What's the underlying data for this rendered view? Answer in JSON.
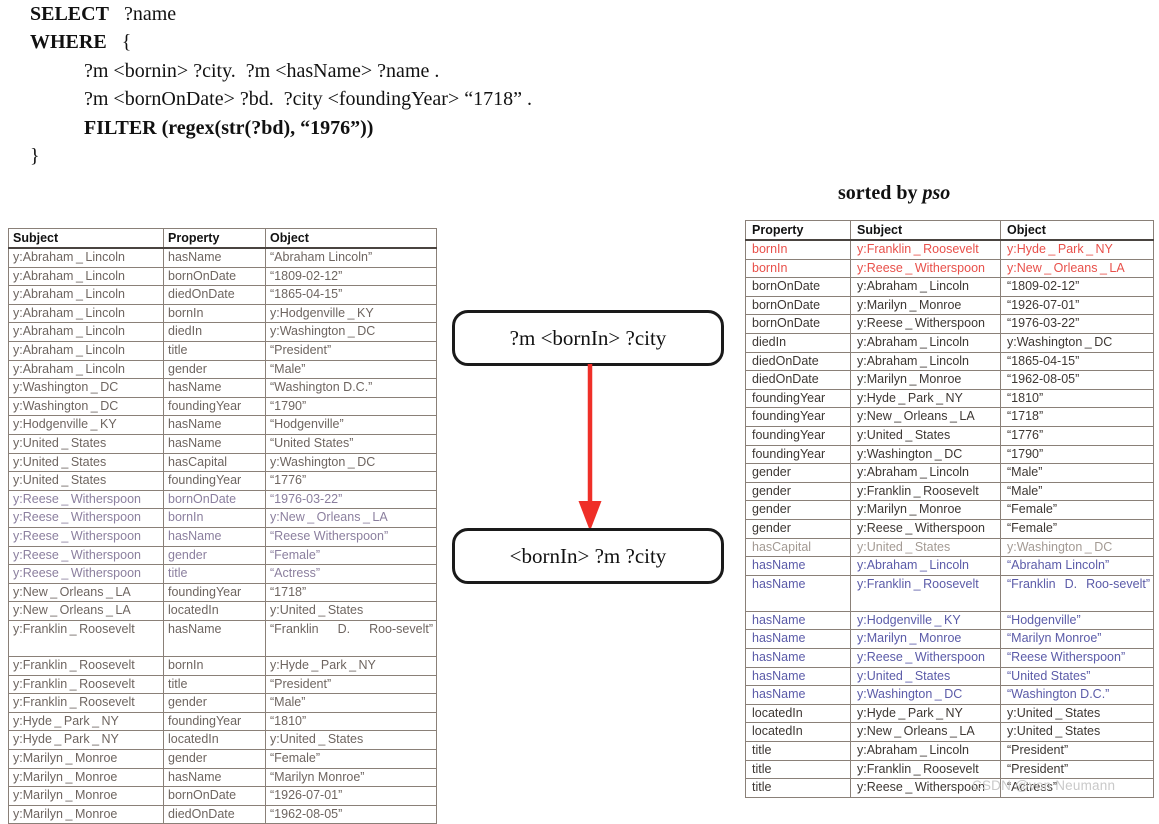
{
  "query": {
    "lines": [
      {
        "kw": "SELECT",
        "rest": "   ?name",
        "indent": 0
      },
      {
        "kw": "WHERE",
        "rest": "   {",
        "indent": 0
      },
      {
        "kw": "",
        "rest": "?m <bornin> ?city.  ?m <hasName> ?name .",
        "indent": 1
      },
      {
        "kw": "",
        "rest": "?m <bornOnDate> ?bd.  ?city <foundingYear> “1718” .",
        "indent": 1
      },
      {
        "kw": "FILTER (regex(str(?bd), “1976”))",
        "rest": "",
        "indent": 2
      },
      {
        "kw": "",
        "rest": "}",
        "indent": 0
      }
    ]
  },
  "caption": {
    "prefix": "sorted by ",
    "emphasis": "pso"
  },
  "left_table": {
    "headers": [
      "Subject",
      "Property",
      "Object"
    ],
    "rows": [
      {
        "color": "c-default",
        "cells": [
          "y:Abraham␣Lincoln",
          "hasName",
          "“Abraham Lincoln”"
        ]
      },
      {
        "color": "c-default",
        "cells": [
          "y:Abraham␣Lincoln",
          "bornOnDate",
          "“1809-02-12”"
        ]
      },
      {
        "color": "c-default",
        "cells": [
          "y:Abraham␣Lincoln",
          "diedOnDate",
          "“1865-04-15”"
        ]
      },
      {
        "color": "c-default",
        "cells": [
          "y:Abraham␣Lincoln",
          "bornIn",
          "y:Hodgenville␣KY"
        ]
      },
      {
        "color": "c-default",
        "cells": [
          "y:Abraham␣Lincoln",
          "diedIn",
          "y:Washington␣DC"
        ]
      },
      {
        "color": "c-default",
        "cells": [
          "y:Abraham␣Lincoln",
          "title",
          "“President”"
        ]
      },
      {
        "color": "c-default",
        "cells": [
          "y:Abraham␣Lincoln",
          "gender",
          "“Male”"
        ]
      },
      {
        "color": "c-default",
        "cells": [
          "y:Washington␣DC",
          "hasName",
          "“Washington D.C.”"
        ]
      },
      {
        "color": "c-default",
        "cells": [
          "y:Washington␣DC",
          "foundingYear",
          "“1790”"
        ]
      },
      {
        "color": "c-default",
        "cells": [
          "y:Hodgenville␣KY",
          "hasName",
          "“Hodgenville”"
        ]
      },
      {
        "color": "c-default",
        "cells": [
          "y:United␣States",
          "hasName",
          "“United States”"
        ]
      },
      {
        "color": "c-default",
        "cells": [
          "y:United␣States",
          "hasCapital",
          "y:Washington␣DC"
        ]
      },
      {
        "color": "c-default",
        "cells": [
          "y:United␣States",
          "foundingYear",
          "“1776”"
        ]
      },
      {
        "color": "c-violet",
        "cells": [
          "y:Reese␣Witherspoon",
          "bornOnDate",
          "“1976-03-22”"
        ]
      },
      {
        "color": "c-violet",
        "cells": [
          "y:Reese␣Witherspoon",
          "bornIn",
          "y:New␣Orleans␣LA"
        ]
      },
      {
        "color": "c-violet",
        "cells": [
          "y:Reese␣Witherspoon",
          "hasName",
          "“Reese Witherspoon”"
        ]
      },
      {
        "color": "c-violet",
        "cells": [
          "y:Reese␣Witherspoon",
          "gender",
          "“Female”"
        ]
      },
      {
        "color": "c-violet",
        "cells": [
          "y:Reese␣Witherspoon",
          "title",
          "“Actress”"
        ]
      },
      {
        "color": "c-default",
        "cells": [
          "y:New␣Orleans␣LA",
          "foundingYear",
          "“1718”"
        ]
      },
      {
        "color": "c-default",
        "cells": [
          "y:New␣Orleans␣LA",
          "locatedIn",
          "y:United␣States"
        ]
      },
      {
        "color": "c-default",
        "tall": true,
        "cells": [
          "y:Franklin␣Roosevelt",
          "hasName",
          "“Franklin D. Roo-sevelt”"
        ]
      },
      {
        "color": "c-default",
        "cells": [
          "y:Franklin␣Roosevelt",
          "bornIn",
          "y:Hyde␣Park␣NY"
        ]
      },
      {
        "color": "c-default",
        "cells": [
          "y:Franklin␣Roosevelt",
          "title",
          "“President”"
        ]
      },
      {
        "color": "c-default",
        "cells": [
          "y:Franklin␣Roosevelt",
          "gender",
          "“Male”"
        ]
      },
      {
        "color": "c-default",
        "cells": [
          "y:Hyde␣Park␣NY",
          "foundingYear",
          "“1810”"
        ]
      },
      {
        "color": "c-default",
        "cells": [
          "y:Hyde␣Park␣NY",
          "locatedIn",
          "y:United␣States"
        ]
      },
      {
        "color": "c-default",
        "cells": [
          "y:Marilyn␣Monroe",
          "gender",
          "“Female”"
        ]
      },
      {
        "color": "c-default",
        "cells": [
          "y:Marilyn␣Monroe",
          "hasName",
          "“Marilyn Monroe”"
        ]
      },
      {
        "color": "c-default",
        "cells": [
          "y:Marilyn␣Monroe",
          "bornOnDate",
          "“1926-07-01”"
        ]
      },
      {
        "color": "c-default",
        "cells": [
          "y:Marilyn␣Monroe",
          "diedOnDate",
          "“1962-08-05”"
        ]
      }
    ]
  },
  "right_table": {
    "headers": [
      "Property",
      "Subject",
      "Object"
    ],
    "rows": [
      {
        "color": "c-red",
        "cells": [
          "bornIn",
          "y:Franklin␣Roosevelt",
          "y:Hyde␣Park␣NY"
        ]
      },
      {
        "color": "c-red",
        "cells": [
          "bornIn",
          "y:Reese␣Witherspoon",
          "y:New␣Orleans␣LA"
        ]
      },
      {
        "color": "c-dark",
        "cells": [
          "bornOnDate",
          "y:Abraham␣Lincoln",
          "“1809-02-12”"
        ]
      },
      {
        "color": "c-dark",
        "cells": [
          "bornOnDate",
          "y:Marilyn␣Monroe",
          "“1926-07-01”"
        ]
      },
      {
        "color": "c-dark",
        "cells": [
          "bornOnDate",
          "y:Reese␣Witherspoon",
          "“1976-03-22”"
        ]
      },
      {
        "color": "c-dark",
        "cells": [
          "diedIn",
          "y:Abraham␣Lincoln",
          "y:Washington␣DC"
        ]
      },
      {
        "color": "c-dark",
        "cells": [
          "diedOnDate",
          "y:Abraham␣Lincoln",
          "“1865-04-15”"
        ]
      },
      {
        "color": "c-dark",
        "cells": [
          "diedOnDate",
          "y:Marilyn␣Monroe",
          "“1962-08-05”"
        ]
      },
      {
        "color": "c-dark",
        "cells": [
          "foundingYear",
          "y:Hyde␣Park␣NY",
          "“1810”"
        ]
      },
      {
        "color": "c-dark",
        "cells": [
          "foundingYear",
          "y:New␣Orleans␣LA",
          "“1718”"
        ]
      },
      {
        "color": "c-dark",
        "cells": [
          "foundingYear",
          "y:United␣States",
          "“1776”"
        ]
      },
      {
        "color": "c-dark",
        "cells": [
          "foundingYear",
          "y:Washington␣DC",
          "“1790”"
        ]
      },
      {
        "color": "c-dark",
        "cells": [
          "gender",
          "y:Abraham␣Lincoln",
          "“Male”"
        ]
      },
      {
        "color": "c-dark",
        "cells": [
          "gender",
          "y:Franklin␣Roosevelt",
          "“Male”"
        ]
      },
      {
        "color": "c-dark",
        "cells": [
          "gender",
          "y:Marilyn␣Monroe",
          "“Female”"
        ]
      },
      {
        "color": "c-dark",
        "cells": [
          "gender",
          "y:Reese␣Witherspoon",
          "“Female”"
        ]
      },
      {
        "color": "c-faint",
        "cells": [
          "hasCapital",
          "y:United␣States",
          "y:Washington␣DC"
        ]
      },
      {
        "color": "c-blue",
        "cells": [
          "hasName",
          "y:Abraham␣Lincoln",
          "“Abraham Lincoln”"
        ]
      },
      {
        "color": "c-blue",
        "tall": true,
        "cells": [
          "hasName",
          "y:Franklin␣Roosevelt",
          "“Franklin D. Roo-sevelt”"
        ]
      },
      {
        "color": "c-blue",
        "cells": [
          "hasName",
          "y:Hodgenville␣KY",
          "“Hodgenville”"
        ]
      },
      {
        "color": "c-blue",
        "cells": [
          "hasName",
          "y:Marilyn␣Monroe",
          "“Marilyn Monroe”"
        ]
      },
      {
        "color": "c-blue",
        "cells": [
          "hasName",
          "y:Reese␣Witherspoon",
          "“Reese Witherspoon”"
        ]
      },
      {
        "color": "c-blue",
        "cells": [
          "hasName",
          "y:United␣States",
          "“United States”"
        ]
      },
      {
        "color": "c-blue",
        "cells": [
          "hasName",
          "y:Washington␣DC",
          "“Washington D.C.”"
        ]
      },
      {
        "color": "c-dark",
        "cells": [
          "locatedIn",
          "y:Hyde␣Park␣NY",
          "y:United␣States"
        ]
      },
      {
        "color": "c-dark",
        "cells": [
          "locatedIn",
          "y:New␣Orleans␣LA",
          "y:United␣States"
        ]
      },
      {
        "color": "c-dark",
        "cells": [
          "title",
          "y:Abraham␣Lincoln",
          "“President”"
        ]
      },
      {
        "color": "c-dark",
        "cells": [
          "title",
          "y:Franklin␣Roosevelt",
          "“President”"
        ]
      },
      {
        "color": "c-dark",
        "cells": [
          "title",
          "y:Reese␣Witherspoon",
          "“Actress”"
        ]
      }
    ]
  },
  "diagram": {
    "top_node": "?m <bornIn> ?city",
    "bottom_node": "<bornIn> ?m ?city",
    "arrow_color": "#ef2f28"
  },
  "watermark": "CSDN @von  Neumann"
}
